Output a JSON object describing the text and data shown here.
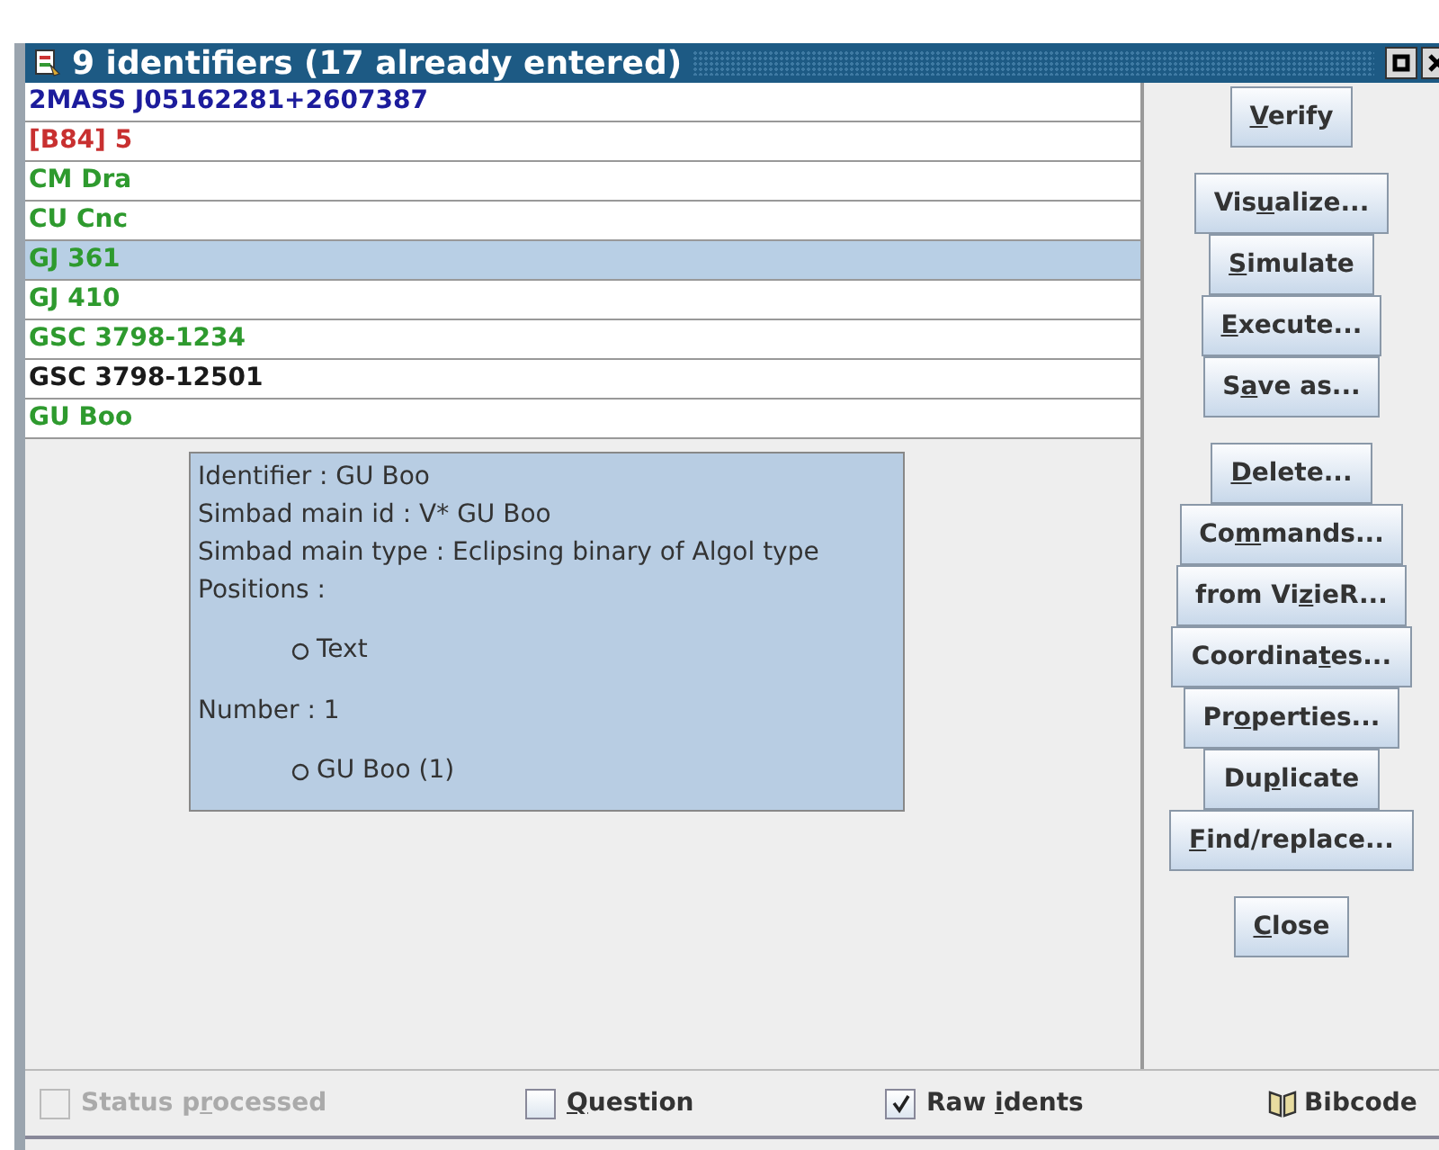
{
  "window": {
    "title": "9 identifiers (17 already entered)"
  },
  "identifiers": [
    {
      "text": "2MASS J05162281+2607387",
      "color": "#1c1c9c",
      "selected": false
    },
    {
      "text": "[B84] 5",
      "color": "#c83030",
      "selected": false
    },
    {
      "text": "CM Dra",
      "color": "#2e9a2e",
      "selected": false
    },
    {
      "text": "CU Cnc",
      "color": "#2e9a2e",
      "selected": false
    },
    {
      "text": "GJ 361",
      "color": "#2e9a2e",
      "selected": true
    },
    {
      "text": "GJ 410",
      "color": "#2e9a2e",
      "selected": false
    },
    {
      "text": "GSC 3798-1234",
      "color": "#2e9a2e",
      "selected": false
    },
    {
      "text": "GSC 3798-12501",
      "color": "#1a1a1a",
      "selected": false
    },
    {
      "text": "GU Boo",
      "color": "#2e9a2e",
      "selected": false
    }
  ],
  "tooltip": {
    "lines": [
      {
        "kind": "text",
        "text": "Identifier : GU Boo"
      },
      {
        "kind": "text",
        "text": "Simbad main id : V* GU Boo"
      },
      {
        "kind": "text",
        "text": "Simbad main type : Eclipsing binary of Algol type"
      },
      {
        "kind": "text",
        "text": "Positions :"
      },
      {
        "kind": "bullet",
        "text": "Text"
      },
      {
        "kind": "text",
        "text": "Number : 1"
      },
      {
        "kind": "bullet",
        "text": "GU Boo (1)"
      }
    ]
  },
  "button_groups": [
    [
      {
        "key": "V",
        "after": "erify"
      }
    ],
    [
      {
        "before": "Vis",
        "key": "u",
        "after": "alize..."
      },
      {
        "key": "S",
        "after": "imulate"
      },
      {
        "key": "E",
        "after": "xecute..."
      },
      {
        "before": "S",
        "key": "a",
        "after": "ve as..."
      }
    ],
    [
      {
        "key": "D",
        "after": "elete..."
      },
      {
        "before": "Co",
        "key": "m",
        "after": "mands..."
      },
      {
        "before": "from Vi",
        "key": "z",
        "after": "ieR..."
      },
      {
        "before": "Coordina",
        "key": "t",
        "after": "es..."
      },
      {
        "before": "Pr",
        "key": "o",
        "after": "perties..."
      },
      {
        "before": "Du",
        "key": "p",
        "after": "licate"
      },
      {
        "key": "F",
        "after": "ind/replace..."
      }
    ],
    [
      {
        "key": "C",
        "after": "lose"
      }
    ]
  ],
  "options": [
    {
      "before": "Status p",
      "key": "r",
      "after": "ocessed",
      "checked": false,
      "disabled": true
    },
    {
      "key": "Q",
      "after": "uestion",
      "checked": false,
      "disabled": false
    },
    {
      "before": "Raw ",
      "key": "i",
      "after": "dents",
      "checked": true,
      "disabled": false
    }
  ],
  "bibcode": {
    "label": "Bibcode"
  }
}
